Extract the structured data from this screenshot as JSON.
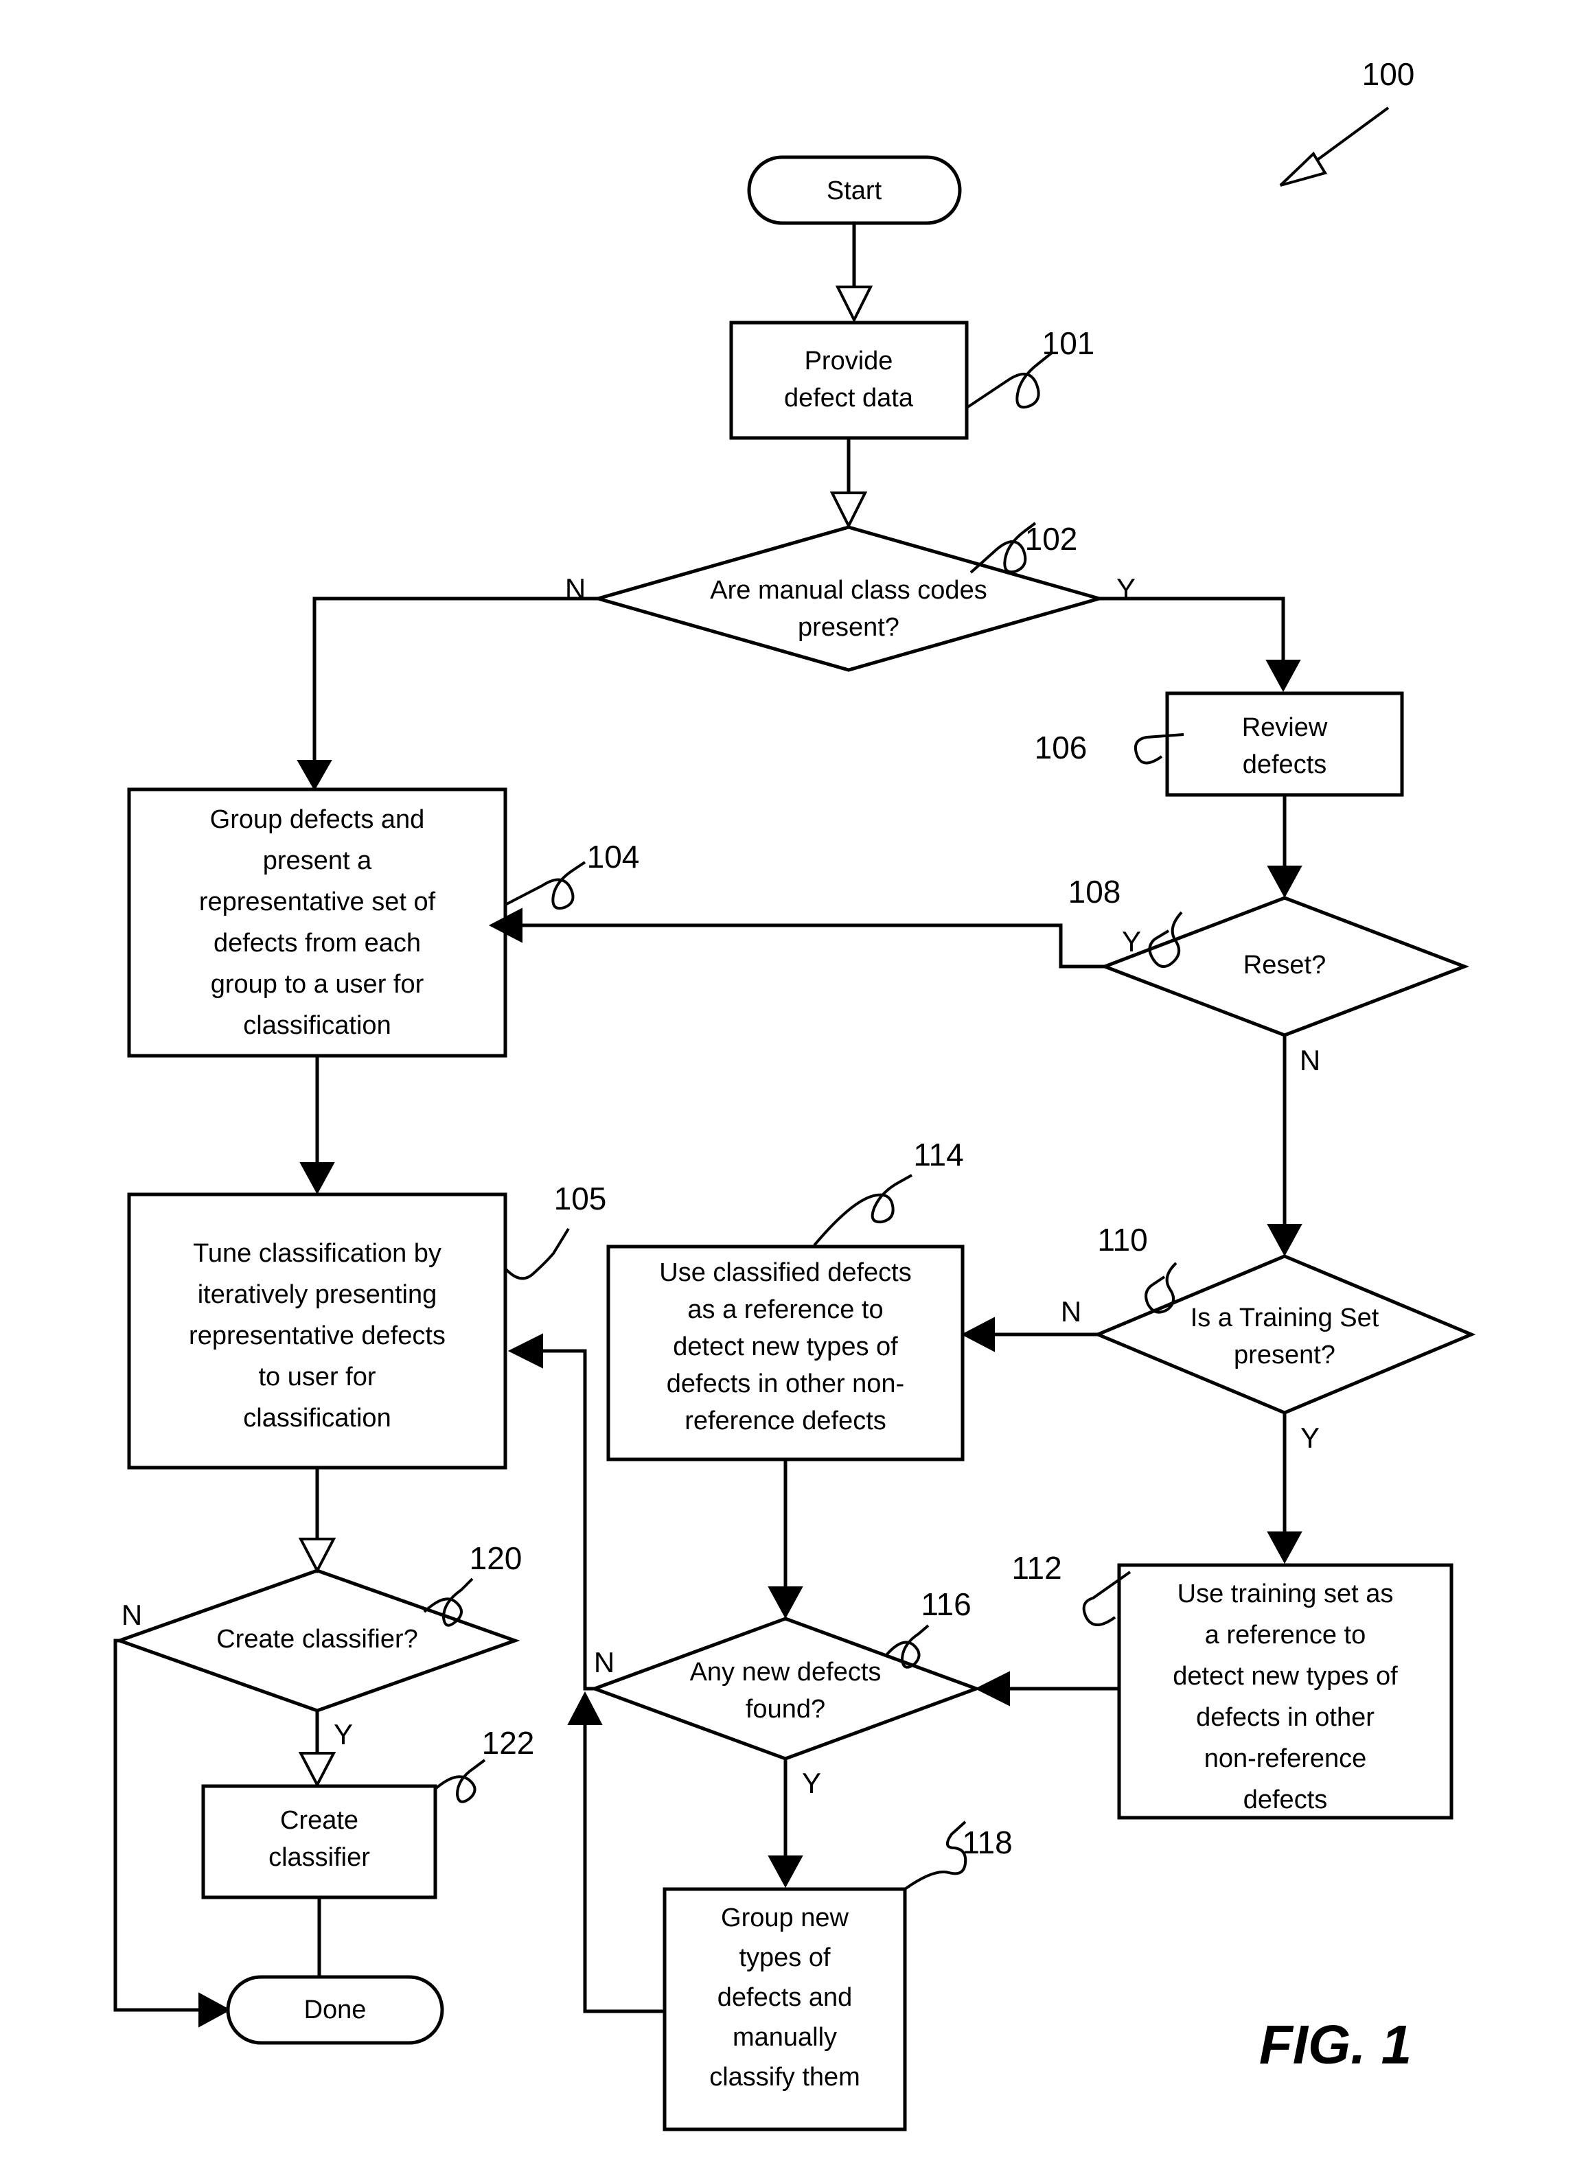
{
  "figure": {
    "caption": "FIG. 1",
    "overall_ref": "100"
  },
  "nodes": {
    "start": {
      "id": "start",
      "type": "terminator",
      "label": "Start"
    },
    "n101": {
      "id": "101",
      "type": "process",
      "ref": "101",
      "label": "Provide\ndefect data",
      "lines": [
        "Provide",
        "defect data"
      ]
    },
    "n102": {
      "id": "102",
      "type": "decision",
      "ref": "102",
      "label": "Are manual class codes present?",
      "lines": [
        "Are manual class codes",
        "present?"
      ]
    },
    "n106": {
      "id": "106",
      "type": "process",
      "ref": "106",
      "label": "Review defects",
      "lines": [
        "Review",
        "defects"
      ]
    },
    "n104": {
      "id": "104",
      "type": "process",
      "ref": "104",
      "label": "Group defects and present a representative set of defects from each group to a user for classification",
      "lines": [
        "Group defects and",
        "present a",
        "representative set of",
        "defects from each",
        "group to a user for",
        "classification"
      ]
    },
    "n108": {
      "id": "108",
      "type": "decision",
      "ref": "108",
      "label": "Reset?",
      "lines": [
        "Reset?"
      ]
    },
    "n105": {
      "id": "105",
      "type": "process",
      "ref": "105",
      "label": "Tune classification by iteratively presenting representative defects to user for classification",
      "lines": [
        "Tune classification by",
        "iteratively presenting",
        "representative defects",
        "to user for",
        "classification"
      ]
    },
    "n114": {
      "id": "114",
      "type": "process",
      "ref": "114",
      "label": "Use classified defects as a reference to detect new types of defects in other non-reference defects",
      "lines": [
        "Use classified defects",
        "as a reference to",
        "detect new types of",
        "defects in other non-",
        "reference defects"
      ]
    },
    "n110": {
      "id": "110",
      "type": "decision",
      "ref": "110",
      "label": "Is a Training Set present?",
      "lines": [
        "Is a Training Set",
        "present?"
      ]
    },
    "n120": {
      "id": "120",
      "type": "decision",
      "ref": "120",
      "label": "Create classifier?",
      "lines": [
        "Create classifier?"
      ]
    },
    "n116": {
      "id": "116",
      "type": "decision",
      "ref": "116",
      "label": "Any new defects found?",
      "lines": [
        "Any new defects",
        "found?"
      ]
    },
    "n112": {
      "id": "112",
      "type": "process",
      "ref": "112",
      "label": "Use training set as a reference to detect new types of defects in other non-reference defects",
      "lines": [
        "Use training set as",
        "a reference to",
        "detect new types of",
        "defects in other",
        "non-reference",
        "defects"
      ]
    },
    "n122": {
      "id": "122",
      "type": "process",
      "ref": "122",
      "label": "Create classifier",
      "lines": [
        "Create",
        "classifier"
      ]
    },
    "n118": {
      "id": "118",
      "type": "process",
      "ref": "118",
      "label": "Group new types of defects and manually classify them",
      "lines": [
        "Group new",
        "types of",
        "defects and",
        "manually",
        "classify them"
      ]
    },
    "done": {
      "id": "done",
      "type": "terminator",
      "label": "Done"
    }
  },
  "branch_labels": {
    "b102_n": "N",
    "b102_y": "Y",
    "b108_y": "Y",
    "b108_n": "N",
    "b110_n": "N",
    "b110_y": "Y",
    "b120_n": "N",
    "b120_y": "Y",
    "b116_n": "N",
    "b116_y": "Y"
  },
  "refs": {
    "r100": "100",
    "r101": "101",
    "r102": "102",
    "r104": "104",
    "r105": "105",
    "r106": "106",
    "r108": "108",
    "r110": "110",
    "r112": "112",
    "r114": "114",
    "r116": "116",
    "r118": "118",
    "r120": "120",
    "r122": "122"
  },
  "colors": {
    "stroke": "#000000",
    "fill": "#ffffff",
    "background": "#ffffff"
  },
  "chart_data": {
    "type": "diagram",
    "title": "FIG. 1",
    "diagram_kind": "flowchart",
    "nodes": [
      {
        "ref": "",
        "shape": "terminator",
        "text": "Start"
      },
      {
        "ref": "101",
        "shape": "process",
        "text": "Provide defect data"
      },
      {
        "ref": "102",
        "shape": "decision",
        "text": "Are manual class codes present?"
      },
      {
        "ref": "106",
        "shape": "process",
        "text": "Review defects"
      },
      {
        "ref": "104",
        "shape": "process",
        "text": "Group defects and present a representative set of defects from each group to a user for classification"
      },
      {
        "ref": "108",
        "shape": "decision",
        "text": "Reset?"
      },
      {
        "ref": "110",
        "shape": "decision",
        "text": "Is a Training Set present?"
      },
      {
        "ref": "105",
        "shape": "process",
        "text": "Tune classification by iteratively presenting representative defects to user for classification"
      },
      {
        "ref": "114",
        "shape": "process",
        "text": "Use classified defects as a reference to detect new types of defects in other non-reference defects"
      },
      {
        "ref": "112",
        "shape": "process",
        "text": "Use training set as a reference to detect new types of defects in other non-reference defects"
      },
      {
        "ref": "120",
        "shape": "decision",
        "text": "Create classifier?"
      },
      {
        "ref": "116",
        "shape": "decision",
        "text": "Any new defects found?"
      },
      {
        "ref": "122",
        "shape": "process",
        "text": "Create classifier"
      },
      {
        "ref": "118",
        "shape": "process",
        "text": "Group new types of defects and manually classify them"
      },
      {
        "ref": "",
        "shape": "terminator",
        "text": "Done"
      }
    ],
    "edges": [
      {
        "from": "Start",
        "to": "101",
        "label": ""
      },
      {
        "from": "101",
        "to": "102",
        "label": ""
      },
      {
        "from": "102",
        "to": "104",
        "label": "N"
      },
      {
        "from": "102",
        "to": "106",
        "label": "Y"
      },
      {
        "from": "106",
        "to": "108",
        "label": ""
      },
      {
        "from": "108",
        "to": "104",
        "label": "Y"
      },
      {
        "from": "108",
        "to": "110",
        "label": "N"
      },
      {
        "from": "110",
        "to": "114",
        "label": "N"
      },
      {
        "from": "110",
        "to": "112",
        "label": "Y"
      },
      {
        "from": "104",
        "to": "105",
        "label": ""
      },
      {
        "from": "114",
        "to": "116",
        "label": ""
      },
      {
        "from": "112",
        "to": "116",
        "label": ""
      },
      {
        "from": "116",
        "to": "118",
        "label": "Y"
      },
      {
        "from": "116",
        "to": "105",
        "label": "N"
      },
      {
        "from": "118",
        "to": "116",
        "label": ""
      },
      {
        "from": "105",
        "to": "120",
        "label": ""
      },
      {
        "from": "120",
        "to": "122",
        "label": "Y"
      },
      {
        "from": "120",
        "to": "Done",
        "label": "N"
      },
      {
        "from": "122",
        "to": "Done",
        "label": ""
      }
    ]
  }
}
